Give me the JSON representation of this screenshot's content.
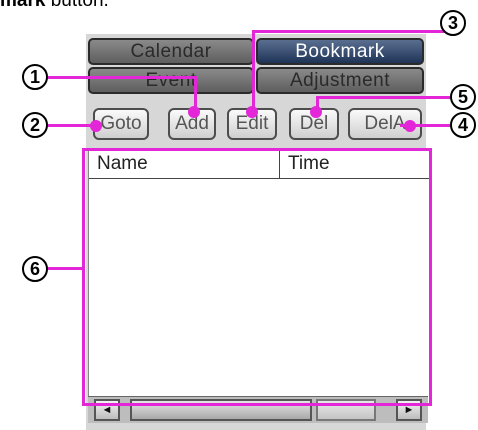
{
  "caption": {
    "bold_text": "mark",
    "rest_text": " button."
  },
  "tabs": {
    "calendar": "Calendar",
    "bookmark": "Bookmark",
    "event": "Event",
    "adjustment": "Adjustment"
  },
  "toolbar": {
    "goto_label": "Goto",
    "add_label": "Add",
    "edit_label": "Edit",
    "del_label": "Del",
    "delall_label": "DelA"
  },
  "list": {
    "columns": [
      "Name",
      "Time"
    ],
    "rows": []
  },
  "scrollbar": {
    "left_arrow": "◄",
    "right_arrow": "►"
  },
  "callouts": [
    "1",
    "2",
    "3",
    "4",
    "5",
    "6"
  ],
  "annotation_color": "#e326d8",
  "active_tab_color": "#1e3356"
}
